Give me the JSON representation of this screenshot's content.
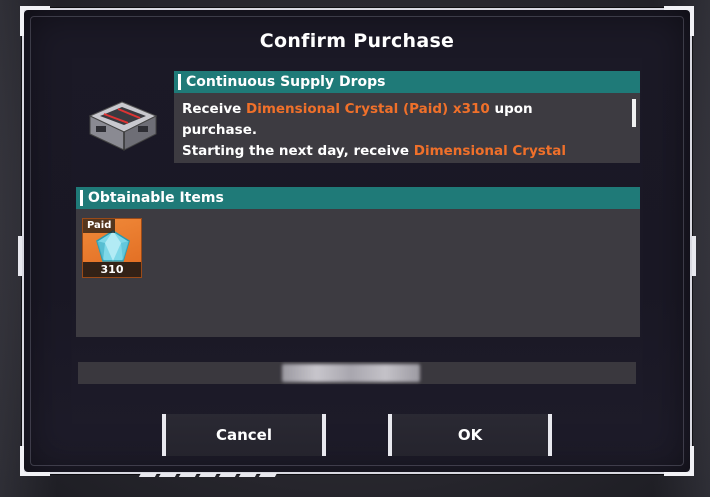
{
  "dialog": {
    "title": "Confirm Purchase"
  },
  "product": {
    "icon": "supply-crate-icon",
    "header": "Continuous Supply Drops",
    "desc_line1_a": "Receive ",
    "desc_line1_hl": "Dimensional Crystal (Paid) x310",
    "desc_line1_b": " upon",
    "desc_line2": "purchase.",
    "desc_line3_a": "Starting the next day, receive ",
    "desc_line3_hl": "Dimensional Crystal"
  },
  "obtainable": {
    "header": "Obtainable Items",
    "items": [
      {
        "tag": "Paid",
        "quantity": "310",
        "icon": "dimensional-crystal-icon"
      }
    ]
  },
  "buttons": {
    "cancel": "Cancel",
    "ok": "OK"
  },
  "colors": {
    "accent_teal": "#1f7a78",
    "highlight_orange": "#f0702a",
    "panel": "#3d3b41",
    "dialog_bg": "#1b1926"
  }
}
